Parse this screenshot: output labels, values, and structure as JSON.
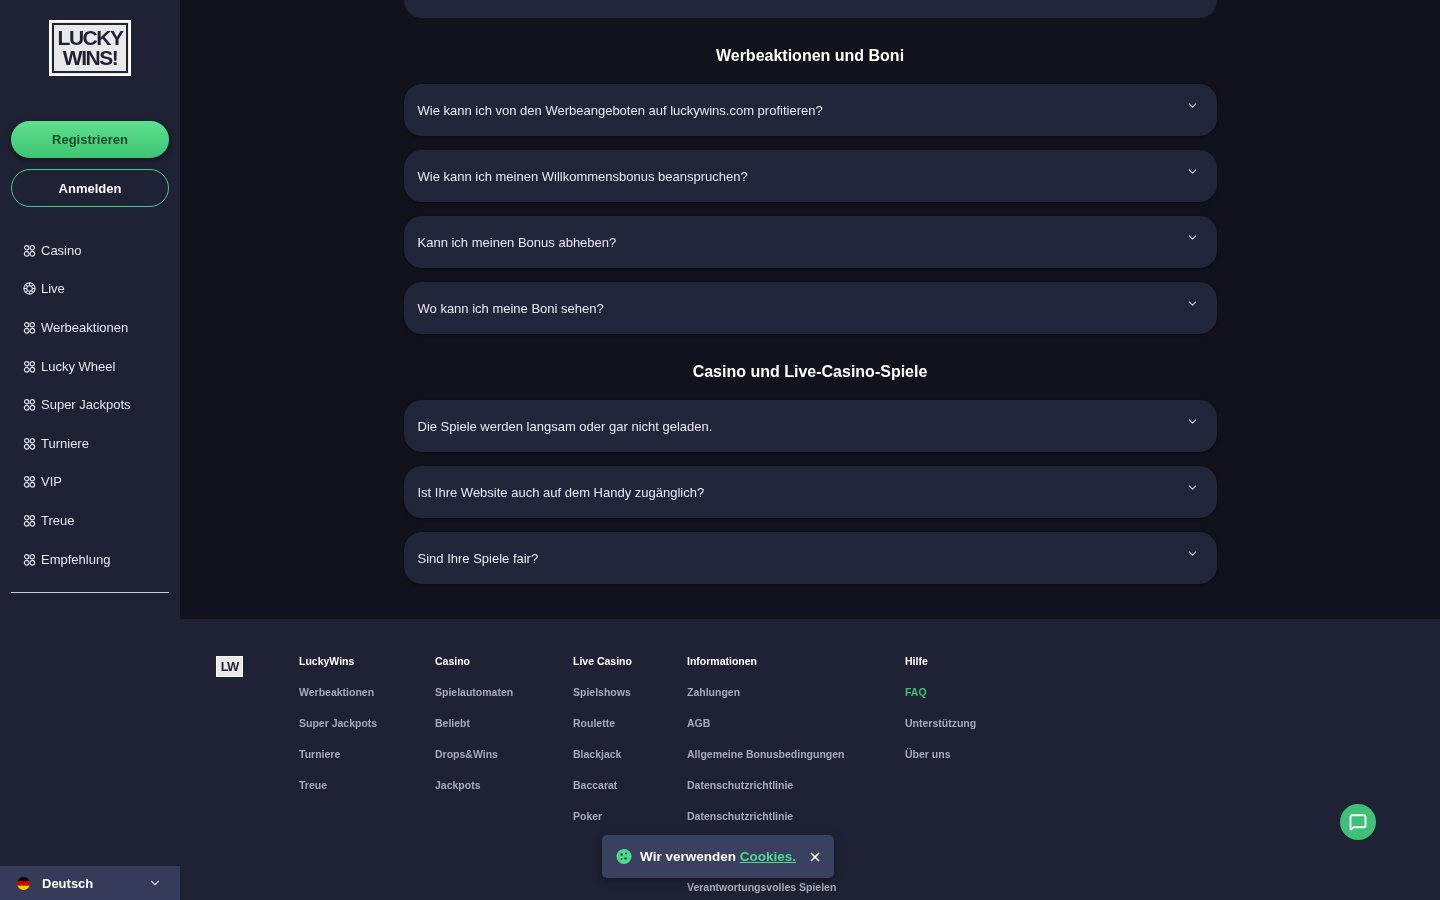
{
  "sidebar": {
    "logo": [
      "LUCKY",
      "WINS!"
    ],
    "register_button": "Registrieren",
    "login_button": "Anmelden",
    "nav": [
      {
        "label": "Casino",
        "kind": "game"
      },
      {
        "label": "Live",
        "kind": "live"
      },
      {
        "label": "Werbeaktionen",
        "kind": "game"
      },
      {
        "label": "Lucky Wheel",
        "kind": "game"
      },
      {
        "label": "Super Jackpots",
        "kind": "game"
      },
      {
        "label": "Turniere",
        "kind": "game"
      },
      {
        "label": "VIP",
        "kind": "game"
      },
      {
        "label": "Treue",
        "kind": "game"
      },
      {
        "label": "Empfehlung",
        "kind": "game"
      }
    ],
    "language": {
      "label": "Deutsch"
    }
  },
  "faq_sections": [
    {
      "title": "Werbeaktionen und Boni",
      "questions": [
        {
          "text": "Wie kann ich von den Werbeangeboten auf luckywins.com profitieren?",
          "expanded": false
        },
        {
          "text": "Wie kann ich meinen Willkommensbonus beanspruchen?",
          "expanded": false
        },
        {
          "text": "Kann ich meinen Bonus abheben?",
          "expanded": false
        },
        {
          "text": "Wo kann ich meine Boni sehen?",
          "expanded": false
        }
      ]
    },
    {
      "title": "Casino und Live-Casino-Spiele",
      "questions": [
        {
          "text": "Die Spiele werden langsam oder gar nicht geladen.",
          "expanded": false
        },
        {
          "text": "Ist Ihre Website auch auf dem Handy zugänglich?",
          "expanded": false
        },
        {
          "text": "Sind Ihre Spiele fair?",
          "expanded": false
        }
      ]
    }
  ],
  "footer": {
    "logo": "LW",
    "columns": [
      {
        "heading": "LuckyWins",
        "links": [
          {
            "label": "Werbeaktionen",
            "selected": false
          },
          {
            "label": "Super Jackpots",
            "selected": false
          },
          {
            "label": "Turniere",
            "selected": false
          },
          {
            "label": "Treue",
            "selected": false
          }
        ]
      },
      {
        "heading": "Casino",
        "links": [
          {
            "label": "Spielautomaten",
            "selected": false
          },
          {
            "label": "Beliebt",
            "selected": false
          },
          {
            "label": "Drops&Wins",
            "selected": false
          },
          {
            "label": "Jackpots",
            "selected": false
          }
        ]
      },
      {
        "heading": "Live Casino",
        "links": [
          {
            "label": "Spielshows",
            "selected": false
          },
          {
            "label": "Roulette",
            "selected": false
          },
          {
            "label": "Blackjack",
            "selected": false
          },
          {
            "label": "Baccarat",
            "selected": false
          },
          {
            "label": "Poker",
            "selected": false
          }
        ]
      },
      {
        "heading": "Informationen",
        "links": [
          {
            "label": "Zahlungen",
            "selected": false
          },
          {
            "label": "AGB",
            "selected": false
          },
          {
            "label": "Allgemeine Bonusbedingungen",
            "selected": false
          },
          {
            "label": "Datenschutzrichtlinie",
            "selected": false
          },
          {
            "label": "Datenschutzrichtlinie",
            "selected": false
          },
          {
            "label": "Verantwortungsvolles Spielen",
            "selected": false
          }
        ]
      },
      {
        "heading": "Hilfe",
        "links": [
          {
            "label": "FAQ",
            "selected": true
          },
          {
            "label": "Unterstützung",
            "selected": false
          },
          {
            "label": "Über uns",
            "selected": false
          }
        ]
      }
    ]
  },
  "cookie_banner": {
    "text": "Wir verwenden",
    "link": "Cookies."
  }
}
